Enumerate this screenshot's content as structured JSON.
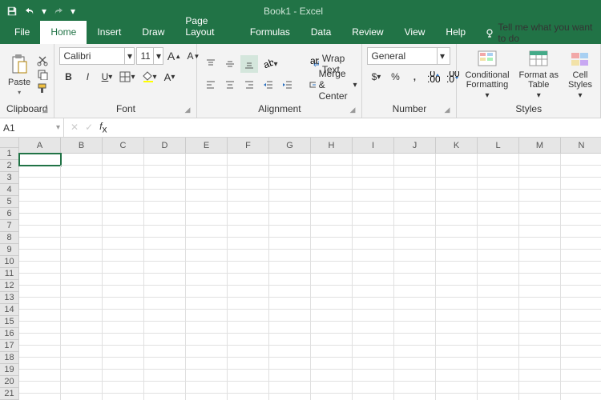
{
  "title": "Book1  -  Excel",
  "tabs": [
    "File",
    "Home",
    "Insert",
    "Draw",
    "Page Layout",
    "Formulas",
    "Data",
    "Review",
    "View",
    "Help"
  ],
  "active_tab": "Home",
  "tellme": "Tell me what you want to do",
  "groups": {
    "clipboard": {
      "label": "Clipboard",
      "paste": "Paste"
    },
    "font": {
      "label": "Font",
      "name": "Calibri",
      "size": "11"
    },
    "alignment": {
      "label": "Alignment",
      "wrap": "Wrap Text",
      "merge": "Merge & Center"
    },
    "number": {
      "label": "Number",
      "format": "General"
    },
    "styles": {
      "label": "Styles",
      "cond": "Conditional\nFormatting",
      "table": "Format as\nTable",
      "cell": "Cell\nStyles"
    }
  },
  "namebox": "A1",
  "columns": [
    "A",
    "B",
    "C",
    "D",
    "E",
    "F",
    "G",
    "H",
    "I",
    "J",
    "K",
    "L",
    "M",
    "N"
  ],
  "rows": 21
}
